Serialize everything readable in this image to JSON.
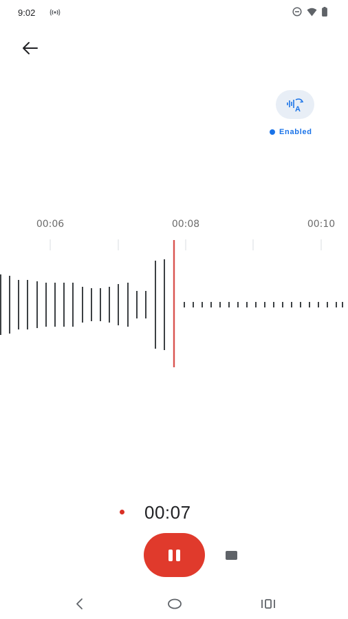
{
  "status_bar": {
    "time": "9:02",
    "icons": [
      "cast-icon",
      "do-not-disturb-icon",
      "wifi-icon",
      "battery-icon"
    ]
  },
  "header": {
    "back_icon": "arrow-left-icon"
  },
  "translate": {
    "icon": "translate-icon",
    "status_label": "Enabled",
    "accent_color": "#1a73e8"
  },
  "timeline": {
    "labels": [
      "00:06",
      "00:08",
      "00:10"
    ]
  },
  "recording": {
    "elapsed": "00:07",
    "indicator_color": "#d93025",
    "playhead_color": "#d9534f"
  },
  "controls": {
    "pause_icon": "pause-icon",
    "stop_icon": "stop-icon",
    "pause_color": "#e03a2c"
  },
  "system_nav": {
    "icons": [
      "back-nav-icon",
      "home-nav-icon",
      "recents-nav-icon"
    ]
  }
}
